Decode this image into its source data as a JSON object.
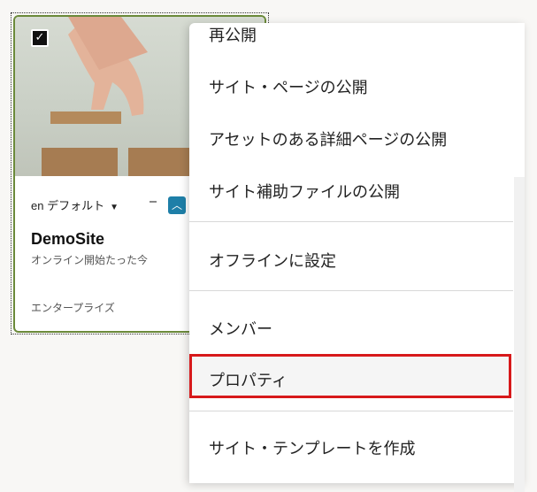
{
  "card": {
    "language_label": "en デフォルト",
    "site_name": "DemoSite",
    "status": "オンライン開始たった今",
    "type": "エンタープライズ"
  },
  "menu": {
    "items": [
      "再公開",
      "サイト・ページの公開",
      "アセットのある詳細ページの公開",
      "サイト補助ファイルの公開",
      "オフラインに設定",
      "メンバー",
      "プロパティ",
      "サイト・テンプレートを作成"
    ]
  },
  "colors": {
    "card_border": "#6b8a3a",
    "toggle": "#1e7fa8",
    "highlight": "#d7191b"
  }
}
